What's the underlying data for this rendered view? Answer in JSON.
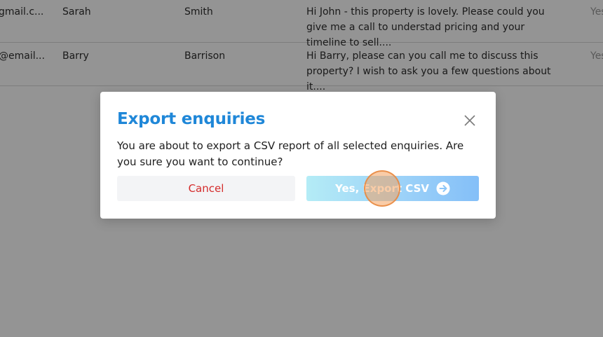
{
  "table": {
    "rows": [
      {
        "email": "gmail.c...",
        "first_name": "Sarah",
        "last_name": "Smith",
        "message": "Hi John - this property is lovely. Please could you give me a call to understad pricing and your timeline to sell....",
        "flag": "Yes"
      },
      {
        "email": "@email...",
        "first_name": "Barry",
        "last_name": "Barrison",
        "message": "Hi Barry, please can you call me to discuss this property? I wish to ask you a few questions about it....",
        "flag": "Yes"
      }
    ]
  },
  "modal": {
    "title": "Export enquiries",
    "body": "You are about to export a CSV report of all selected enquiries. Are you sure you want to continue?",
    "cancel_label": "Cancel",
    "confirm_label": "Yes, Export CSV",
    "close_icon": "close-icon",
    "confirm_icon": "arrow-right-circle-icon"
  },
  "colors": {
    "title": "#1f87d8",
    "cancel_text": "#d42b2b",
    "overlay": "rgba(0,0,0,0.42)"
  }
}
